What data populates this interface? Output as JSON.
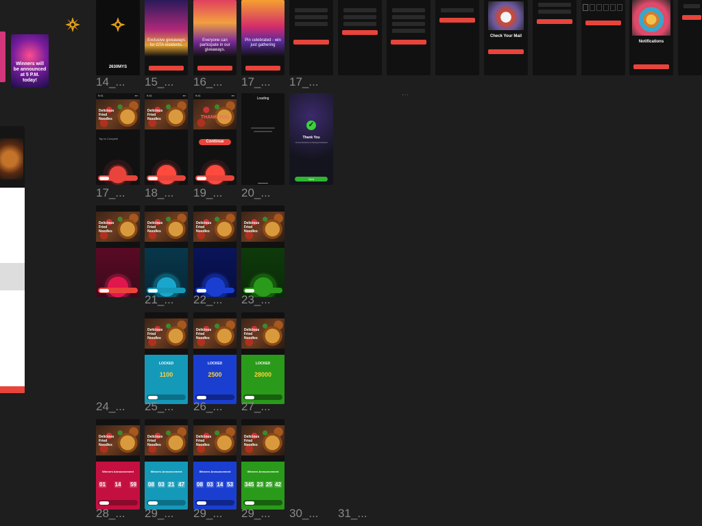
{
  "labels": [
    "14_...",
    "15_...",
    "16_...",
    "17_...",
    "17_...",
    "17_...",
    "18_...",
    "19_...",
    "20_...",
    "21_...",
    "22_...",
    "23_...",
    "24_...",
    "25_...",
    "26_...",
    "27_...",
    "28_...",
    "29_...",
    "29_...",
    "29_...",
    "30_...",
    "31_..."
  ],
  "top": {
    "logo": "2630MYS",
    "onb15": "Exclusive giveaways for GTA residents.",
    "onb16": "Everyone can participate in our giveaways.",
    "onb17": "Pin celebrated - win just gathering",
    "next": "Next",
    "continue": "Continue",
    "check_mail_title": "Check Your Mail",
    "notif_title": "Notifications"
  },
  "promo": {
    "headline": "Winners will be announced at 5 P.M. today!"
  },
  "row2": {
    "app_title": "NOODLES",
    "tap_prompt": "Tap to Compete",
    "tap": "Tap",
    "thank_title": "THANK YOU",
    "continue": "Continue",
    "loading": "Loading",
    "thank_you": "Thank You",
    "thank_sub": "Your prize/entry is being processed",
    "next": "Next"
  },
  "row4": {
    "locked": "LOCKED",
    "amounts": [
      "1100",
      "2500",
      "28000"
    ]
  },
  "row5": {
    "winners": "Winners Announcement",
    "counts": [
      [
        "01",
        "14",
        "59"
      ],
      [
        "08",
        "03",
        "21",
        "47"
      ],
      [
        "08",
        "03",
        "14",
        "53"
      ],
      [
        "345",
        "23",
        "25",
        "42"
      ]
    ]
  },
  "colors": {
    "accent": "#e9443b",
    "crimson": "#c41040",
    "teal": "#1599b8",
    "blue": "#1a3fd0",
    "green": "#2a9a1a",
    "success": "#3ad13a"
  }
}
